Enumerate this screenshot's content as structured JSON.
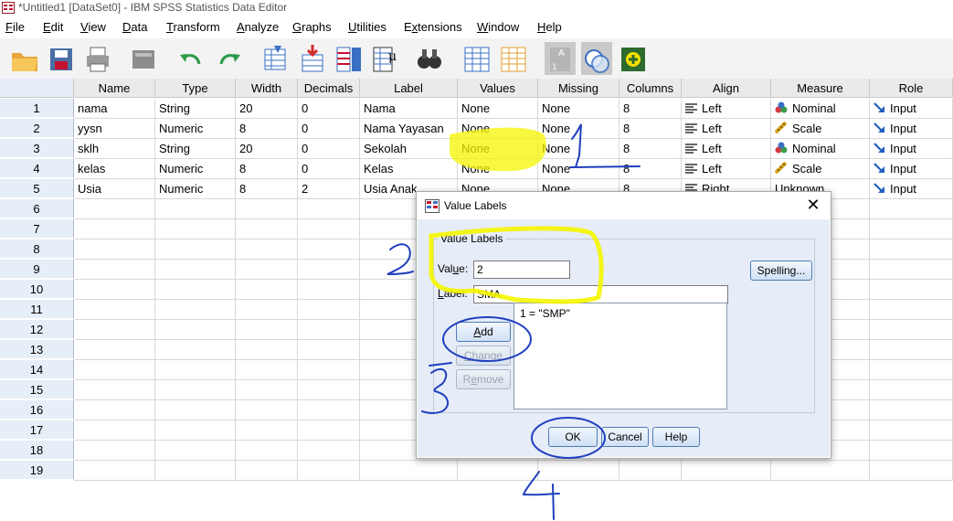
{
  "window": {
    "title": "*Untitled1 [DataSet0] - IBM SPSS Statistics Data Editor"
  },
  "menu": [
    {
      "label": "File",
      "mn": "F"
    },
    {
      "label": "Edit",
      "mn": "E"
    },
    {
      "label": "View",
      "mn": "V"
    },
    {
      "label": "Data",
      "mn": "D"
    },
    {
      "label": "Transform",
      "mn": "T"
    },
    {
      "label": "Analyze",
      "mn": "A"
    },
    {
      "label": "Graphs",
      "mn": "G"
    },
    {
      "label": "Utilities",
      "mn": "U"
    },
    {
      "label": "Extensions",
      "mn": "x"
    },
    {
      "label": "Window",
      "mn": "W"
    },
    {
      "label": "Help",
      "mn": "H"
    }
  ],
  "toolbar": [
    "open-folder-icon",
    "save-icon",
    "print-icon",
    "dialog-recall-icon",
    "undo-icon",
    "redo-icon",
    "goto-case-icon",
    "goto-variable-icon",
    "variables-icon",
    "value-labels-icon",
    "find-icon",
    "insert-cases-icon",
    "insert-variable-icon",
    "split-file-icon",
    "weight-cases-icon",
    "select-cases-icon",
    "use-sets-icon"
  ],
  "grid": {
    "columns": [
      "Name",
      "Type",
      "Width",
      "Decimals",
      "Label",
      "Values",
      "Missing",
      "Columns",
      "Align",
      "Measure",
      "Role"
    ],
    "row_numbers": [
      "1",
      "2",
      "3",
      "4",
      "5",
      "6",
      "7",
      "8",
      "9",
      "10",
      "11",
      "12",
      "13",
      "14",
      "15",
      "16",
      "17",
      "18",
      "19"
    ],
    "rows": [
      {
        "name": "nama",
        "type": "String",
        "width": "20",
        "decimals": "0",
        "label": "Nama",
        "values": "None",
        "missing": "None",
        "columns": "8",
        "align": "Left",
        "measure": "Nominal",
        "measure_icon": "nominal-icon",
        "role": "Input"
      },
      {
        "name": "yysn",
        "type": "Numeric",
        "width": "8",
        "decimals": "0",
        "label": "Nama Yayasan",
        "values": "None",
        "missing": "None",
        "columns": "8",
        "align": "Left",
        "measure": "Scale",
        "measure_icon": "scale-icon",
        "role": "Input"
      },
      {
        "name": "sklh",
        "type": "String",
        "width": "20",
        "decimals": "0",
        "label": "Sekolah",
        "values": "None",
        "missing": "None",
        "columns": "8",
        "align": "Left",
        "measure": "Nominal",
        "measure_icon": "nominal-icon",
        "role": "Input"
      },
      {
        "name": "kelas",
        "type": "Numeric",
        "width": "8",
        "decimals": "0",
        "label": "Kelas",
        "values": "None",
        "missing": "None",
        "columns": "8",
        "align": "Left",
        "measure": "Scale",
        "measure_icon": "scale-icon",
        "role": "Input"
      },
      {
        "name": "Usia",
        "type": "Numeric",
        "width": "8",
        "decimals": "2",
        "label": "Usia Anak",
        "values": "None",
        "missing": "None",
        "columns": "8",
        "align": "Right",
        "measure": "Unknown",
        "measure_icon": "",
        "role": "Input"
      }
    ]
  },
  "dialog": {
    "title": "Value Labels",
    "group_label": "Value Labels",
    "value_label": "Value:",
    "value_mn": "u",
    "value": "2",
    "label_label": "Label:",
    "label_mn": "L",
    "label": "SMA",
    "list_items": [
      "1 = \"SMP\""
    ],
    "spelling": "Spelling...",
    "add": "Add",
    "add_mn": "A",
    "change": "Change",
    "change_mn": "C",
    "remove": "Remove",
    "remove_mn": "e",
    "ok": "OK",
    "cancel": "Cancel",
    "help": "Help"
  },
  "annotations": {
    "numbers": [
      "1",
      "2",
      "3",
      "4"
    ],
    "highlight_color": "#f5f500",
    "ink_color": "#1f3fbf"
  }
}
